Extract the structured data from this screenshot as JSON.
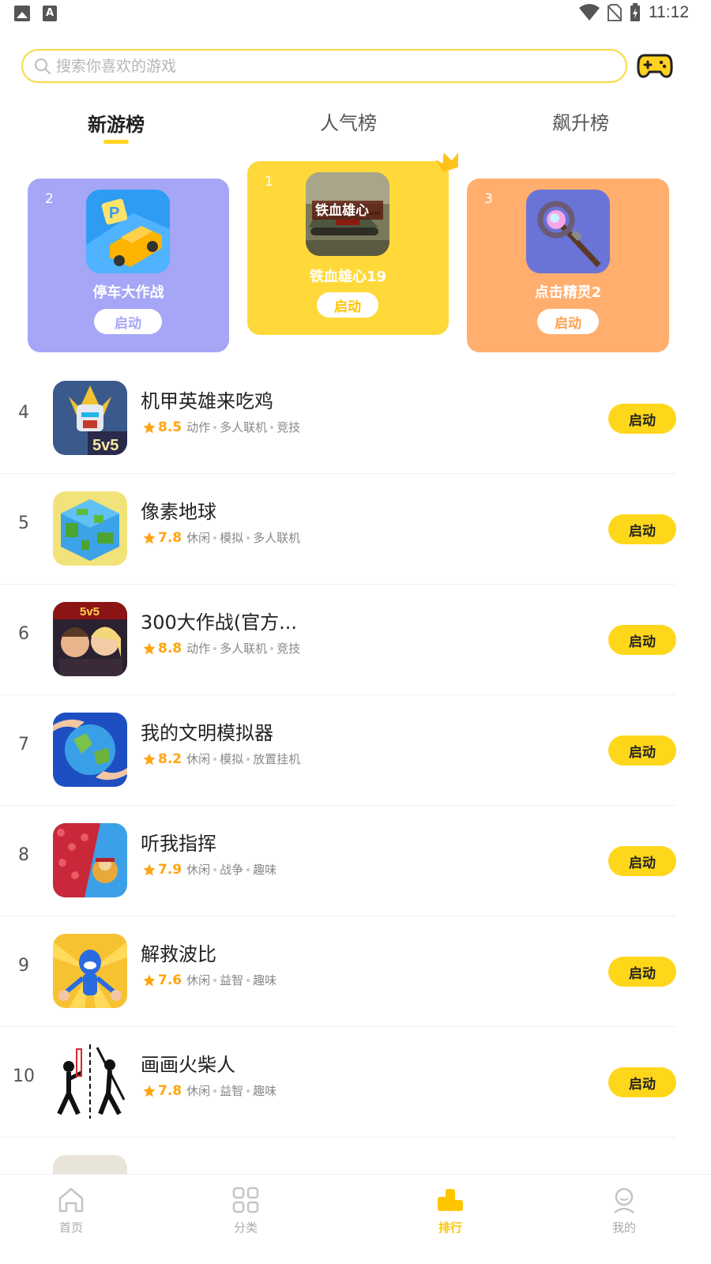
{
  "status_bar": {
    "time": "11:12"
  },
  "search": {
    "placeholder": "搜索你喜欢的游戏"
  },
  "tabs": [
    {
      "label": "新游榜",
      "active": true
    },
    {
      "label": "人气榜",
      "active": false
    },
    {
      "label": "飙升榜",
      "active": false
    }
  ],
  "podium": [
    {
      "rank": "1",
      "name": "铁血雄心19",
      "button": "启动",
      "color": "#FFD93A"
    },
    {
      "rank": "2",
      "name": "停车大作战",
      "button": "启动",
      "color": "#A5A6F6"
    },
    {
      "rank": "3",
      "name": "点击精灵2",
      "button": "启动",
      "color": "#FFAE6E"
    }
  ],
  "list": [
    {
      "rank": "4",
      "title": "机甲英雄来吃鸡",
      "score": "8.5",
      "tags": [
        "动作",
        "多人联机",
        "竞技"
      ],
      "button": "启动"
    },
    {
      "rank": "5",
      "title": "像素地球",
      "score": "7.8",
      "tags": [
        "休闲",
        "模拟",
        "多人联机"
      ],
      "button": "启动"
    },
    {
      "rank": "6",
      "title": "300大作战(官方...",
      "score": "8.8",
      "tags": [
        "动作",
        "多人联机",
        "竞技"
      ],
      "button": "启动"
    },
    {
      "rank": "7",
      "title": "我的文明模拟器",
      "score": "8.2",
      "tags": [
        "休闲",
        "模拟",
        "放置挂机"
      ],
      "button": "启动"
    },
    {
      "rank": "8",
      "title": "听我指挥",
      "score": "7.9",
      "tags": [
        "休闲",
        "战争",
        "趣味"
      ],
      "button": "启动"
    },
    {
      "rank": "9",
      "title": "解救波比",
      "score": "7.6",
      "tags": [
        "休闲",
        "益智",
        "趣味"
      ],
      "button": "启动"
    },
    {
      "rank": "10",
      "title": "画画火柴人",
      "score": "7.8",
      "tags": [
        "休闲",
        "益智",
        "趣味"
      ],
      "button": "启动"
    }
  ],
  "bottom_nav": [
    {
      "label": "首页",
      "icon": "home-icon",
      "active": false
    },
    {
      "label": "分类",
      "icon": "category-icon",
      "active": false
    },
    {
      "label": "排行",
      "icon": "ranking-icon",
      "active": true
    },
    {
      "label": "我的",
      "icon": "profile-icon",
      "active": false
    }
  ],
  "colors": {
    "accent": "#FFD71A",
    "score": "#FFA412",
    "search_border": "#F7D944"
  }
}
